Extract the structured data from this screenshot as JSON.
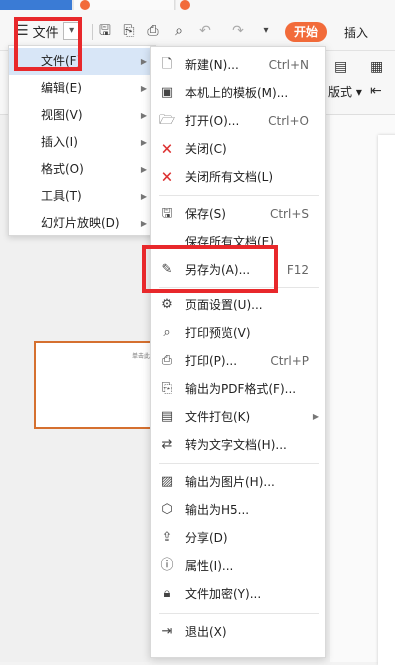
{
  "colors": {
    "accent": "#f26b3a",
    "highlight": "#e8282b",
    "menu_active": "#d8e6f7",
    "blue_tab": "#3a7bd5"
  },
  "toolbar": {
    "file_label": "文件",
    "start_label": "开始",
    "insert_label": "插入",
    "icons": [
      "menu-icon",
      "save-icon",
      "format-painter-icon",
      "print-icon",
      "print-preview-icon",
      "undo-icon",
      "redo-icon",
      "more-icon"
    ]
  },
  "ribbon2": {
    "layout_label": "版式",
    "arrow": "▾"
  },
  "slide": {
    "thumb_text": "单击此"
  },
  "menu1": {
    "items": [
      {
        "label": "文件(F)",
        "active": true
      },
      {
        "label": "编辑(E)"
      },
      {
        "label": "视图(V)"
      },
      {
        "label": "插入(I)"
      },
      {
        "label": "格式(O)"
      },
      {
        "label": "工具(T)"
      },
      {
        "label": "幻灯片放映(D)"
      }
    ]
  },
  "menu2": {
    "items": [
      {
        "label": "新建(N)...",
        "shortcut": "Ctrl+N",
        "icon": "new-file-icon"
      },
      {
        "label": "本机上的模板(M)...",
        "icon": "template-icon"
      },
      {
        "label": "打开(O)...",
        "shortcut": "Ctrl+O",
        "icon": "open-folder-icon"
      },
      {
        "label": "关闭(C)",
        "icon": "close-file-icon"
      },
      {
        "label": "关闭所有文档(L)",
        "icon": "close-all-icon"
      },
      {
        "label": "保存(S)",
        "shortcut": "Ctrl+S",
        "icon": "save-icon"
      },
      {
        "label": "保存所有文档(E)"
      },
      {
        "label": "另存为(A)...",
        "shortcut": "F12",
        "icon": "save-as-icon"
      },
      {
        "label": "页面设置(U)...",
        "icon": "page-setup-icon"
      },
      {
        "label": "打印预览(V)",
        "icon": "print-preview-icon"
      },
      {
        "label": "打印(P)...",
        "shortcut": "Ctrl+P",
        "icon": "print-icon"
      },
      {
        "label": "输出为PDF格式(F)...",
        "icon": "pdf-icon"
      },
      {
        "label": "文件打包(K)",
        "submenu": true,
        "icon": "package-icon"
      },
      {
        "label": "转为文字文档(H)...",
        "icon": "convert-text-icon"
      },
      {
        "label": "输出为图片(H)...",
        "icon": "image-export-icon"
      },
      {
        "label": "输出为H5...",
        "icon": "html5-icon"
      },
      {
        "label": "分享(D)",
        "icon": "share-icon"
      },
      {
        "label": "属性(I)...",
        "icon": "properties-icon"
      },
      {
        "label": "文件加密(Y)...",
        "icon": "encrypt-icon"
      },
      {
        "label": "退出(X)",
        "icon": "exit-icon"
      }
    ]
  }
}
